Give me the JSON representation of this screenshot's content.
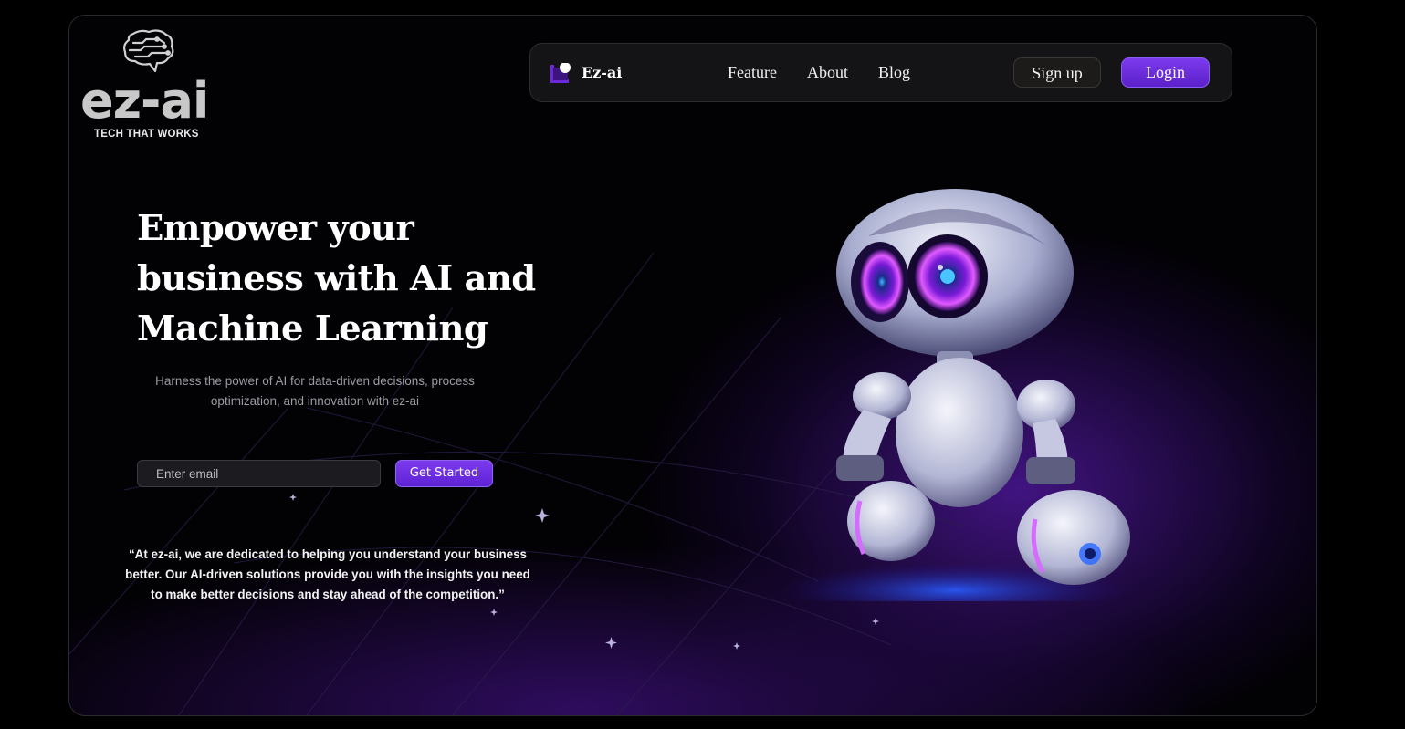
{
  "brand": {
    "wordmark": "ez-ai",
    "tagline": "TECH THAT WORKS",
    "icon": "brain-circuit-icon",
    "color": "#c8c8c8"
  },
  "navbar": {
    "logo_text": "Ez-ai",
    "logo_icon": "ez-ai-logo-icon",
    "links": [
      "Feature",
      "About",
      "Blog"
    ],
    "signup_label": "Sign up",
    "login_label": "Login"
  },
  "hero": {
    "title": "Empower your business with AI and Machine Learning",
    "subtitle": "Harness the power of AI for data-driven decisions, process optimization, and innovation with ez-ai",
    "email_placeholder": "Enter email",
    "cta_label": "Get Started",
    "quote": "“At ez-ai, we are dedicated to helping you understand your business better. Our AI-driven solutions provide you with the insights you need to make better decisions and stay ahead of the competition.”",
    "image": "robot-illustration"
  },
  "colors": {
    "background": "#020104",
    "accent": "#7c3aed",
    "glow": "#561aaa"
  }
}
